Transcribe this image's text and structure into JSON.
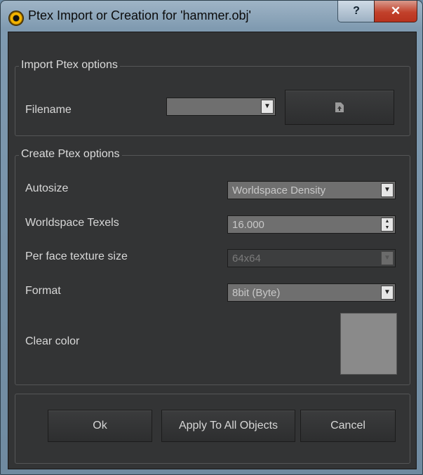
{
  "window": {
    "title": "Ptex Import or Creation for 'hammer.obj'",
    "help_label": "?",
    "close_label": "✕"
  },
  "import_group": {
    "title": "Import Ptex options",
    "filename_label": "Filename",
    "filename_value": "",
    "browse_icon": "file-open-icon"
  },
  "create_group": {
    "title": "Create Ptex options",
    "autosize_label": "Autosize",
    "autosize_value": "Worldspace Density",
    "texels_label": "Worldspace Texels",
    "texels_value": "16.000",
    "face_size_label": "Per face texture size",
    "face_size_value": "64x64",
    "format_label": "Format",
    "format_value": "8bit (Byte)",
    "clear_color_label": "Clear color",
    "clear_color": "#8a8a8a"
  },
  "buttons": {
    "ok": "Ok",
    "apply_all": "Apply To All Objects",
    "cancel": "Cancel"
  }
}
